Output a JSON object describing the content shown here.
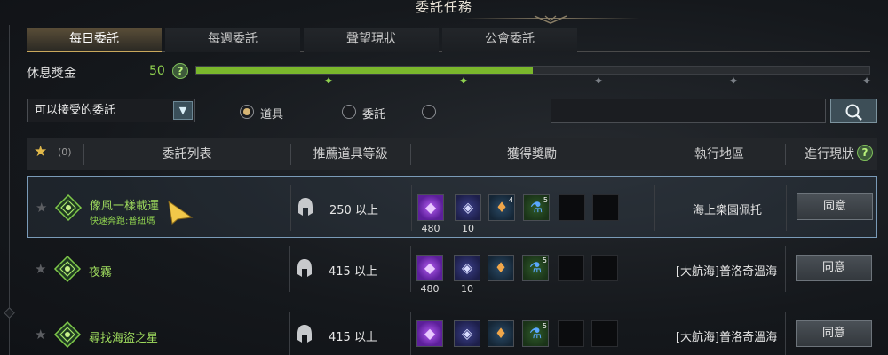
{
  "window": {
    "title": "委託任務"
  },
  "tabs": [
    {
      "label": "每日委託",
      "active": true
    },
    {
      "label": "每週委託",
      "active": false
    },
    {
      "label": "聲望現狀",
      "active": false
    },
    {
      "label": "公會委託",
      "active": false
    }
  ],
  "rest_bonus": {
    "label": "休息獎金",
    "value": "50",
    "help": "?",
    "fill_fraction": 0.5,
    "marker_count": 5,
    "markers_reached": 2
  },
  "filter": {
    "select_value": "可以接受的委託",
    "radios": [
      {
        "label": "道具",
        "checked": true
      },
      {
        "label": "委託",
        "checked": false
      },
      {
        "label": "",
        "checked": false
      }
    ],
    "search_placeholder": ""
  },
  "table": {
    "favorite_count": "(0)",
    "headers": {
      "list": "委託列表",
      "level": "推薦道具等級",
      "reward": "獲得獎勵",
      "region": "執行地區",
      "status": "進行現狀"
    },
    "status_help": "?",
    "rows": [
      {
        "name": "像風一樣載運",
        "subtitle": "快速奔跑:普紐瑪",
        "level": "250 以上",
        "rewards": [
          {
            "icon": "exp-gem-icon",
            "value": "480",
            "count": ""
          },
          {
            "icon": "crystal-icon",
            "value": "10",
            "count": ""
          },
          {
            "icon": "ore-icon",
            "value": "",
            "count": "4"
          },
          {
            "icon": "potion-icon",
            "value": "",
            "count": "5"
          }
        ],
        "region": "海上樂園佩托",
        "button": "同意",
        "selected": true
      },
      {
        "name": "夜霧",
        "subtitle": "",
        "level": "415 以上",
        "rewards": [
          {
            "icon": "exp-gem-icon",
            "value": "480",
            "count": ""
          },
          {
            "icon": "crystal-icon",
            "value": "10",
            "count": ""
          },
          {
            "icon": "ore-icon",
            "value": "",
            "count": ""
          },
          {
            "icon": "potion-icon",
            "value": "",
            "count": "5"
          }
        ],
        "region": "[大航海]普洛奇溫海",
        "button": "同意",
        "selected": false
      },
      {
        "name": "尋找海盜之星",
        "subtitle": "",
        "level": "415 以上",
        "rewards": [
          {
            "icon": "exp-gem-icon",
            "value": "",
            "count": ""
          },
          {
            "icon": "crystal-icon",
            "value": "",
            "count": ""
          },
          {
            "icon": "ore-icon",
            "value": "",
            "count": ""
          },
          {
            "icon": "potion-icon",
            "value": "",
            "count": "5"
          }
        ],
        "region": "[大航海]普洛奇溫海",
        "button": "同意",
        "selected": false
      }
    ]
  },
  "colors": {
    "accent_green": "#8fd14f",
    "gold": "#c9a85c",
    "star": "#e0b84a"
  }
}
